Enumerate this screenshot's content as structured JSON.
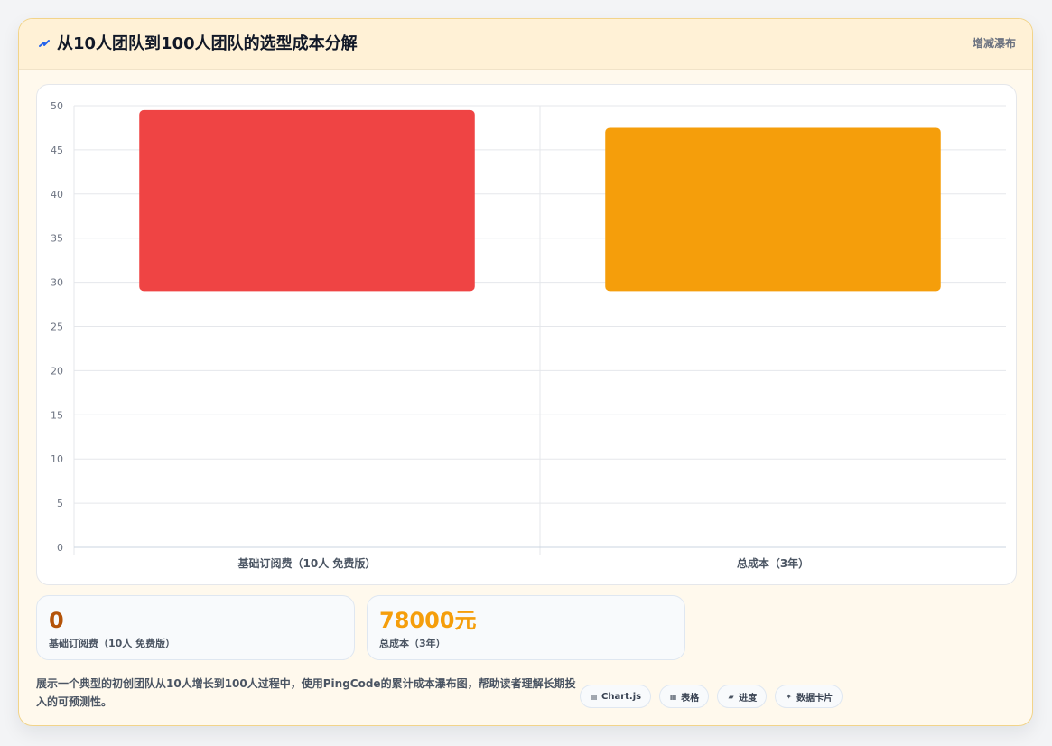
{
  "header": {
    "icon": "waterfall-icon",
    "title": "从10人团队到100人团队的选型成本分解",
    "chart_type_label": "增减瀑布"
  },
  "chart_data": {
    "type": "bar",
    "title": "",
    "xlabel": "",
    "ylabel": "",
    "ylim": [
      0,
      50
    ],
    "yticks": [
      0,
      5,
      10,
      15,
      20,
      25,
      30,
      35,
      40,
      45,
      50
    ],
    "grid": true,
    "categories": [
      "基础订阅费（10人 免费版）",
      "总成本（3年）"
    ],
    "series": [
      {
        "ranges": [
          {
            "category": "基础订阅费（10人 免费版）",
            "start": 29,
            "end": 49.5,
            "color": "#ef4444"
          },
          {
            "category": "总成本（3年）",
            "start": 29,
            "end": 47.5,
            "color": "#f59e0b"
          }
        ]
      }
    ]
  },
  "stats": [
    {
      "value": "0",
      "label": "基础订阅费（10人 免费版）",
      "color": "#b45309"
    },
    {
      "value": "78000元",
      "label": "总成本（3年）",
      "color": "#f59e0b"
    }
  ],
  "description": "展示一个典型的初创团队从10人增长到100人过程中，使用PingCode的累计成本瀑布图，帮助读者理解长期投入的可预测性。",
  "tags": [
    {
      "icon": "chart-icon",
      "label": "Chart.js"
    },
    {
      "icon": "table-icon",
      "label": "表格"
    },
    {
      "icon": "progress-icon",
      "label": "进度"
    },
    {
      "icon": "data-card-icon",
      "label": "数据卡片"
    }
  ],
  "colors": {
    "header_background": "#fff1d6",
    "card_background": "#fff9ed",
    "border": "#f2d48a",
    "grid": "#e5e7eb",
    "axis_text": "#6b7280"
  }
}
